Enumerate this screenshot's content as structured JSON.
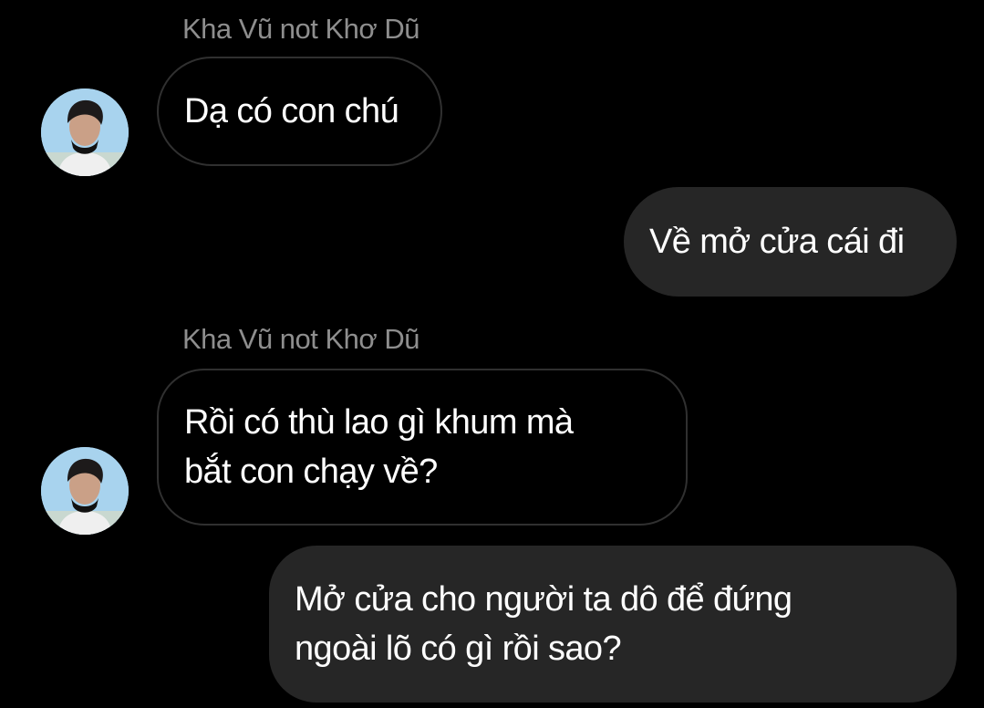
{
  "thread": {
    "messages": [
      {
        "direction": "incoming",
        "sender": "Kha Vũ not Khơ Dũ",
        "lines": [
          "Dạ có con chú"
        ]
      },
      {
        "direction": "outgoing",
        "lines": [
          "Về mở cửa cái đi"
        ]
      },
      {
        "direction": "incoming",
        "sender": "Kha Vũ not Khơ Dũ",
        "lines": [
          "Rồi có thù lao gì khum mà",
          "bắt con chạy về?"
        ]
      },
      {
        "direction": "outgoing",
        "lines": [
          "Mở cửa cho người ta dô để đứng",
          "ngoài lõ có gì rồi sao?"
        ]
      }
    ]
  },
  "colors": {
    "background": "#000000",
    "incoming_bubble_border": "#303030",
    "outgoing_bubble_fill": "#262626",
    "message_text": "#ffffff",
    "sender_name_text": "#8e8e8e"
  }
}
